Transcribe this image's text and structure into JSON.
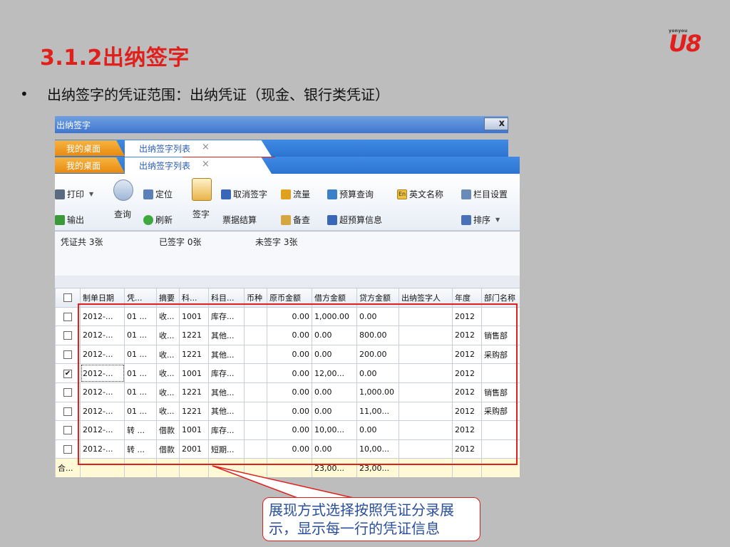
{
  "slide": {
    "title": "3.1.2出纳签字",
    "bullet_marker": "•",
    "bullet_text": "出纳签字的凭证范围：出纳凭证（现金、银行类凭证）",
    "logo_small": "yonyou",
    "logo_main": "U8",
    "callout": "展现方式选择按照凭证分录展示，显示每一行的凭证信息"
  },
  "window": {
    "title": "出纳签字",
    "close_label": "x",
    "tabs": {
      "desk": "我的桌面",
      "list": "出纳签字列表",
      "close": "×"
    }
  },
  "toolbar": {
    "print": "打印",
    "export": "输出",
    "query": "查询",
    "locate": "定位",
    "refresh": "刷新",
    "sign": "签字",
    "cancel_sign": "取消签字",
    "settle": "票据结算",
    "flow": "流量",
    "check": "备查",
    "budget_query": "预算查询",
    "over_budget": "超预算信息",
    "english_name": "英文名称",
    "en_badge": "En",
    "column_settings": "栏目设置",
    "sort": "排序"
  },
  "status": {
    "total": "凭证共 3张",
    "signed": "已签字 0张",
    "unsigned": "未签字 3张"
  },
  "grid": {
    "headers": [
      "制单日期",
      "凭...",
      "摘要",
      "科...",
      "科目...",
      "币种",
      "原币金额",
      "借方金额",
      "贷方金额",
      "出纳签字人",
      "年度",
      "部门名称"
    ],
    "rows": [
      {
        "checked": "",
        "date": "2012-...",
        "voucher": "01 ...",
        "summary": "收...",
        "acct_code": "1001",
        "acct_name": "库存...",
        "currency": "",
        "orig": "0.00",
        "debit": "1,000.00",
        "credit": "0.00",
        "signer": "",
        "year": "2012",
        "dept": ""
      },
      {
        "checked": "",
        "date": "2012-...",
        "voucher": "01 ...",
        "summary": "收...",
        "acct_code": "1221",
        "acct_name": "其他...",
        "currency": "",
        "orig": "0.00",
        "debit": "0.00",
        "credit": "800.00",
        "signer": "",
        "year": "2012",
        "dept": "销售部"
      },
      {
        "checked": "",
        "date": "2012-...",
        "voucher": "01 ...",
        "summary": "收...",
        "acct_code": "1221",
        "acct_name": "其他...",
        "currency": "",
        "orig": "0.00",
        "debit": "0.00",
        "credit": "200.00",
        "signer": "",
        "year": "2012",
        "dept": "采购部"
      },
      {
        "checked": "✔",
        "date": "2012-...",
        "voucher": "01 ...",
        "summary": "收...",
        "acct_code": "1001",
        "acct_name": "库存...",
        "currency": "",
        "orig": "0.00",
        "debit": "12,00...",
        "credit": "0.00",
        "signer": "",
        "year": "2012",
        "dept": ""
      },
      {
        "checked": "",
        "date": "2012-...",
        "voucher": "01 ...",
        "summary": "收...",
        "acct_code": "1221",
        "acct_name": "其他...",
        "currency": "",
        "orig": "0.00",
        "debit": "0.00",
        "credit": "1,000.00",
        "signer": "",
        "year": "2012",
        "dept": "销售部"
      },
      {
        "checked": "",
        "date": "2012-...",
        "voucher": "01 ...",
        "summary": "收...",
        "acct_code": "1221",
        "acct_name": "其他...",
        "currency": "",
        "orig": "0.00",
        "debit": "0.00",
        "credit": "11,00...",
        "signer": "",
        "year": "2012",
        "dept": "采购部"
      },
      {
        "checked": "",
        "date": "2012-...",
        "voucher": "转 ...",
        "summary": "借款",
        "acct_code": "1001",
        "acct_name": "库存...",
        "currency": "",
        "orig": "0.00",
        "debit": "10,00...",
        "credit": "0.00",
        "signer": "",
        "year": "2012",
        "dept": ""
      },
      {
        "checked": "",
        "date": "2012-...",
        "voucher": "转 ...",
        "summary": "借款",
        "acct_code": "2001",
        "acct_name": "短期...",
        "currency": "",
        "orig": "0.00",
        "debit": "0.00",
        "credit": "10,00...",
        "signer": "",
        "year": "2012",
        "dept": ""
      }
    ],
    "total": {
      "label": "合...",
      "debit": "23,00...",
      "credit": "23,00..."
    }
  },
  "colors": {
    "accent_red": "#e0201c",
    "title_bar": "#3f76cf",
    "tab_orange": "#e88a10"
  }
}
